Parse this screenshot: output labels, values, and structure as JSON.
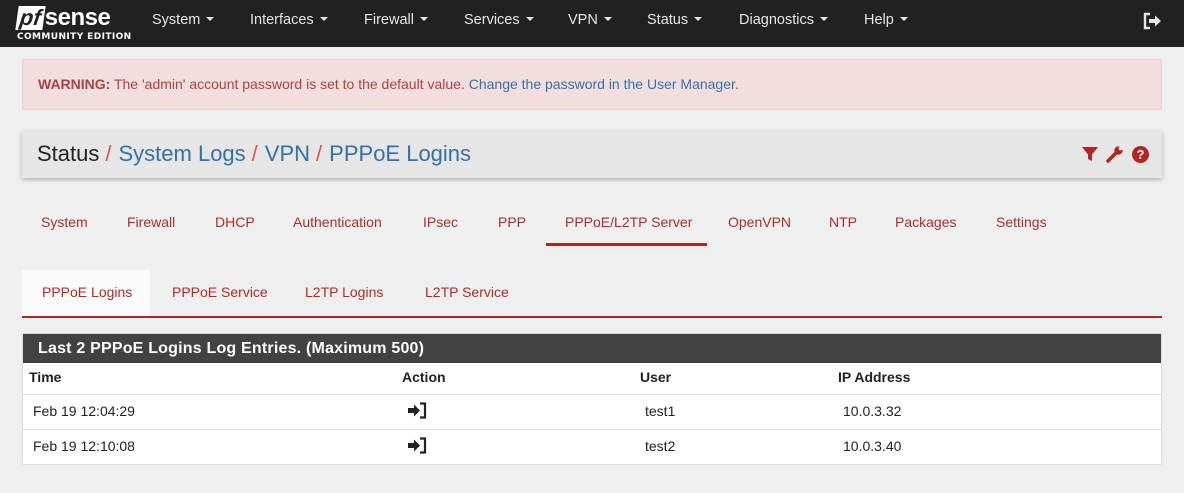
{
  "logo": {
    "brand": "pfsense",
    "edition": "COMMUNITY EDITION"
  },
  "nav": {
    "items": [
      {
        "label": "System"
      },
      {
        "label": "Interfaces"
      },
      {
        "label": "Firewall"
      },
      {
        "label": "Services"
      },
      {
        "label": "VPN"
      },
      {
        "label": "Status"
      },
      {
        "label": "Diagnostics"
      },
      {
        "label": "Help"
      }
    ],
    "logout_icon": "sign-out-icon"
  },
  "alert": {
    "label": "WARNING:",
    "text": "The 'admin' account password is set to the default value.",
    "link": "Change the password in the User Manager."
  },
  "breadcrumb": {
    "items": [
      "Status",
      "System Logs",
      "VPN",
      "PPPoE Logins"
    ],
    "separator": "/",
    "icons": [
      "filter-icon",
      "wrench-icon",
      "help-icon"
    ]
  },
  "tabs_primary": {
    "items": [
      "System",
      "Firewall",
      "DHCP",
      "Authentication",
      "IPsec",
      "PPP",
      "PPPoE/L2TP Server",
      "OpenVPN",
      "NTP",
      "Packages",
      "Settings"
    ],
    "active": "PPPoE/L2TP Server"
  },
  "tabs_secondary": {
    "items": [
      "PPPoE Logins",
      "PPPoE Service",
      "L2TP Logins",
      "L2TP Service"
    ],
    "active": "PPPoE Logins"
  },
  "log_panel": {
    "title": "Last 2 PPPoE Logins Log Entries. (Maximum 500)",
    "columns": [
      "Time",
      "Action",
      "User",
      "IP Address"
    ],
    "rows": [
      {
        "time": "Feb 19 12:04:29",
        "action_icon": "sign-in-icon",
        "user": "test1",
        "ip": "10.0.3.32"
      },
      {
        "time": "Feb 19 12:10:08",
        "action_icon": "sign-in-icon",
        "user": "test2",
        "ip": "10.0.3.40"
      }
    ]
  },
  "colors": {
    "navbar": "#212121",
    "accent_red": "#b12623",
    "link_blue": "#3571a6",
    "alert_bg": "#f2dede",
    "panel_head": "#424242"
  }
}
